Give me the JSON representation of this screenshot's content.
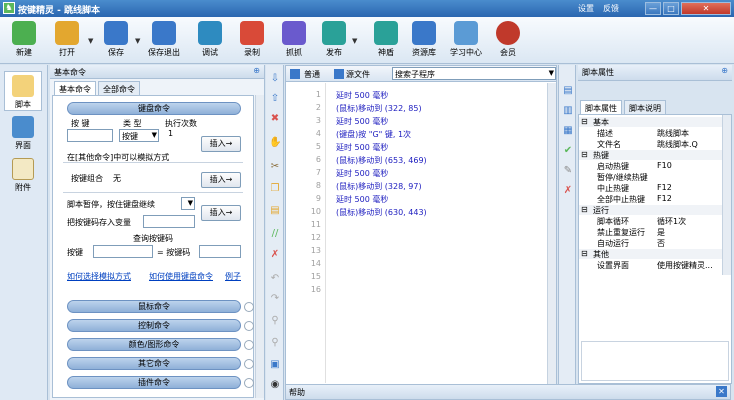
{
  "window": {
    "title": "按键精灵 - 跳线脚本",
    "links": [
      "设置",
      "反馈"
    ],
    "controls": [
      "—",
      "□",
      "✕"
    ]
  },
  "toolbar": {
    "items": [
      {
        "label": "新建",
        "icon": "new-icon",
        "color": "#4caf50"
      },
      {
        "label": "打开",
        "icon": "open-icon",
        "color": "#e3a72f"
      },
      {
        "label": "保存",
        "icon": "save-icon",
        "color": "#3a78c9"
      },
      {
        "label": "保存退出",
        "icon": "save-exit-icon",
        "color": "#3a78c9"
      },
      {
        "label": "调试",
        "icon": "debug-icon",
        "color": "#2e8bc0"
      },
      {
        "label": "录制",
        "icon": "record-icon",
        "color": "#d94a38"
      },
      {
        "label": "抓抓",
        "icon": "grab-icon",
        "color": "#6a5acd"
      },
      {
        "label": "发布",
        "icon": "publish-icon",
        "color": "#2aa198"
      },
      {
        "label": "神盾",
        "icon": "shield-icon",
        "color": "#2aa198"
      },
      {
        "label": "资源库",
        "icon": "library-icon",
        "color": "#3a78c9"
      },
      {
        "label": "学习中心",
        "icon": "learn-icon",
        "color": "#5b9bd5"
      },
      {
        "label": "会员",
        "icon": "member-icon",
        "color": "#c0392b"
      }
    ]
  },
  "vtabs": [
    {
      "label": "脚本"
    },
    {
      "label": "界面"
    },
    {
      "label": "附件"
    }
  ],
  "left_panel": {
    "title": "基本命令",
    "tabs": [
      "基本命令",
      "全部命令"
    ],
    "keyboard": {
      "header": "键盘命令",
      "col_key": "按 键",
      "col_type": "类 型",
      "col_count": "执行次数",
      "type_value": "按键",
      "count_value": "1",
      "insert": "插入→",
      "note": "在[其他命令]中可以模拟方式",
      "combo_label": "按键组合",
      "combo_value": "无",
      "pause_label": "脚本暂停，按住键盘继续",
      "save_label": "把按键码存入变量",
      "query_title": "查询按键码",
      "query_key": "按键",
      "query_code": "= 按键码"
    },
    "links": [
      "如何选择模拟方式",
      "如何使用键盘命令",
      "例子"
    ],
    "categories": [
      "鼠标命令",
      "控制命令",
      "颜色/图形命令",
      "其它命令",
      "插件命令"
    ]
  },
  "editor": {
    "mode_tabs": [
      "普通",
      "源文件"
    ],
    "search_placeholder": "搜索子程序",
    "line_numbers": [
      "1",
      "2",
      "3",
      "4",
      "5",
      "6",
      "7",
      "8",
      "9",
      "10",
      "11",
      "12",
      "13",
      "14",
      "15",
      "16"
    ],
    "lines": [
      "延时 500 毫秒",
      "(鼠标)移动到 (322, 85)",
      "延时 500 毫秒",
      "(键盘)按 \"G\" 键, 1次",
      "延时 500 毫秒",
      "(鼠标)移动到 (653, 469)",
      "延时 500 毫秒",
      "(鼠标)移动到 (328, 97)",
      "延时 500 毫秒",
      "(鼠标)移动到 (630, 443)"
    ]
  },
  "help": {
    "label": "帮助"
  },
  "right_panel": {
    "title": "脚本属性",
    "tabs": [
      "脚本属性",
      "脚本说明"
    ],
    "sections": [
      {
        "name": "基本",
        "rows": [
          {
            "k": "描述",
            "v": "跳线脚本"
          },
          {
            "k": "文件名",
            "v": "跳线脚本.Q"
          }
        ]
      },
      {
        "name": "热键",
        "rows": [
          {
            "k": "启动热键",
            "v": "F10"
          },
          {
            "k": "暂停/继续热键",
            "v": ""
          },
          {
            "k": "中止热键",
            "v": "F12"
          },
          {
            "k": "全部中止热键",
            "v": "F12"
          }
        ]
      },
      {
        "name": "运行",
        "rows": [
          {
            "k": "脚本循环",
            "v": "循环1次"
          },
          {
            "k": "禁止重复运行",
            "v": "是"
          },
          {
            "k": "自动运行",
            "v": "否"
          }
        ]
      },
      {
        "name": "其他",
        "rows": [
          {
            "k": "设置界面",
            "v": "使用按键精灵..."
          }
        ]
      }
    ]
  }
}
